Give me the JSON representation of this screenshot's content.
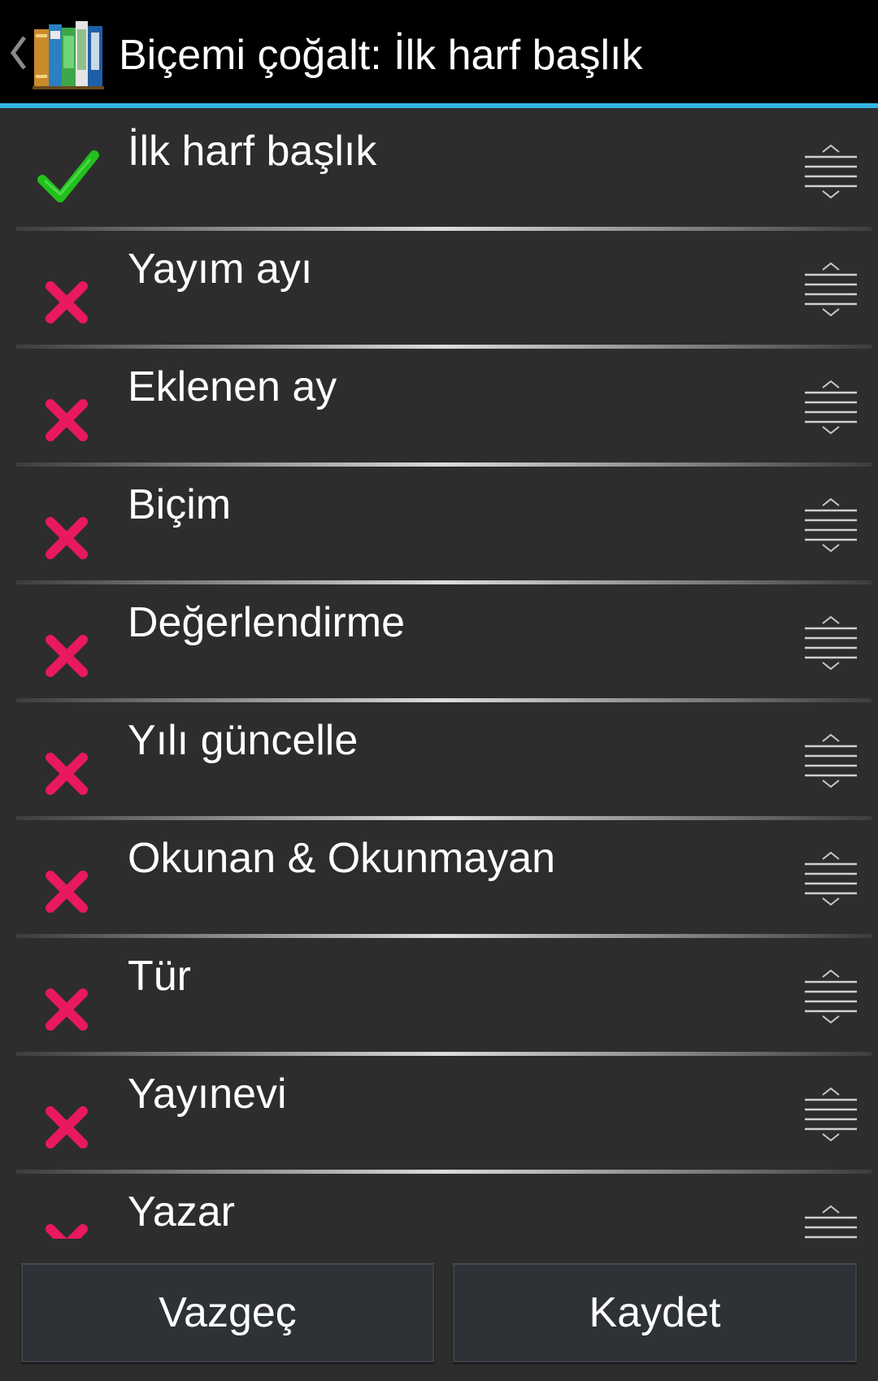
{
  "header": {
    "title": "Biçemi çoğalt: İlk harf başlık",
    "back_icon": "chevron-left-icon",
    "app_icon": "books-app-icon"
  },
  "colors": {
    "accent": "#33b5e5",
    "check": "#22c01d",
    "cross": "#e8195c",
    "background": "#2d2d2d",
    "actionbar": "#000000"
  },
  "list": {
    "items": [
      {
        "label": "İlk harf başlık",
        "enabled": true
      },
      {
        "label": "Yayım ayı",
        "enabled": false
      },
      {
        "label": "Eklenen ay",
        "enabled": false
      },
      {
        "label": "Biçim",
        "enabled": false
      },
      {
        "label": "Değerlendirme",
        "enabled": false
      },
      {
        "label": "Yılı güncelle",
        "enabled": false
      },
      {
        "label": "Okunan & Okunmayan",
        "enabled": false
      },
      {
        "label": "Tür",
        "enabled": false
      },
      {
        "label": "Yayınevi",
        "enabled": false
      },
      {
        "label": "Yazar",
        "enabled": false
      }
    ]
  },
  "buttons": {
    "cancel_label": "Vazgeç",
    "save_label": "Kaydet"
  }
}
